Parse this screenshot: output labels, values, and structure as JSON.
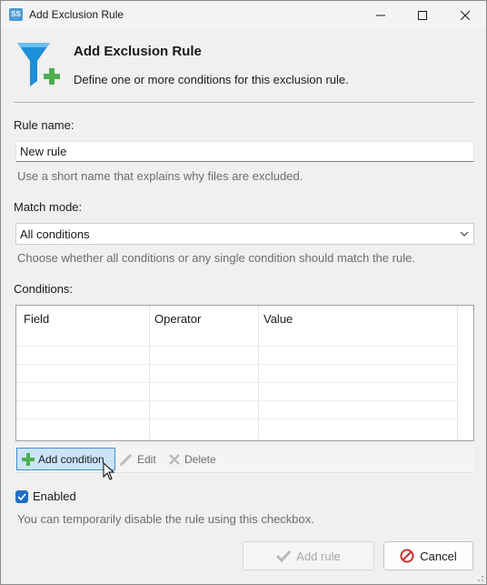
{
  "window": {
    "title": "Add Exclusion Rule",
    "app_icon_text": "SS"
  },
  "header": {
    "title": "Add Exclusion Rule",
    "subtitle": "Define one or more conditions for this exclusion rule."
  },
  "rule_name": {
    "label": "Rule name:",
    "value": "New rule",
    "hint": "Use a short name that explains why files are excluded."
  },
  "match_mode": {
    "label": "Match mode:",
    "selected": "All conditions",
    "hint": "Choose whether all conditions or any single condition should match the rule."
  },
  "conditions": {
    "label": "Conditions:",
    "columns": [
      "Field",
      "Operator",
      "Value"
    ],
    "rows": []
  },
  "toolbar": {
    "add_label": "Add condition",
    "edit_label": "Edit",
    "delete_label": "Delete"
  },
  "enabled": {
    "label": "Enabled",
    "checked": true,
    "hint": "You can temporarily disable the rule using this checkbox."
  },
  "footer": {
    "add_rule_label": "Add rule",
    "cancel_label": "Cancel"
  },
  "colors": {
    "accent": "#1f6fc6",
    "funnel": "#1e8fd8",
    "plus": "#4caf50",
    "cancel_icon": "#d32f2f"
  }
}
